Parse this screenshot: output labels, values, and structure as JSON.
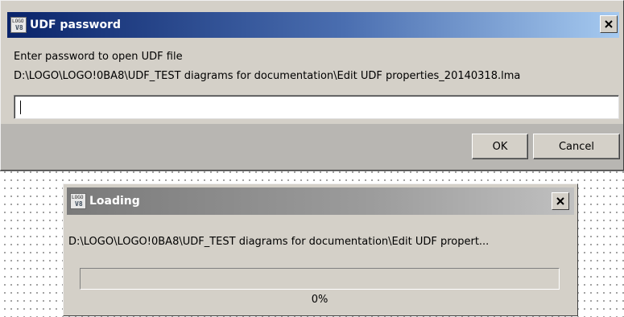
{
  "udf_dialog": {
    "title": "UDF password",
    "prompt": "Enter password to open UDF file",
    "file_path": "D:\\LOGO\\LOGO!0BA8\\UDF_TEST diagrams for documentation\\Edit UDF properties_20140318.lma",
    "password_value": "",
    "ok_label": "OK",
    "cancel_label": "Cancel",
    "close_label": "×",
    "logo_text": "LOGO"
  },
  "loading_dialog": {
    "title": "Loading",
    "file_path": "D:\\LOGO\\LOGO!0BA8\\UDF_TEST diagrams for documentation\\Edit UDF propert...",
    "progress_percent": 0,
    "progress_label": "0%",
    "close_label": "×",
    "logo_text": "LOGO"
  },
  "icons": {
    "app": "logo-app-icon",
    "close": "close-icon"
  },
  "colors": {
    "active_title_start": "#0a246a",
    "active_title_end": "#a6caf0",
    "inactive_title_start": "#7a7a7a",
    "dialog_face": "#d4d0c8",
    "button_row": "#b8b6b2"
  }
}
